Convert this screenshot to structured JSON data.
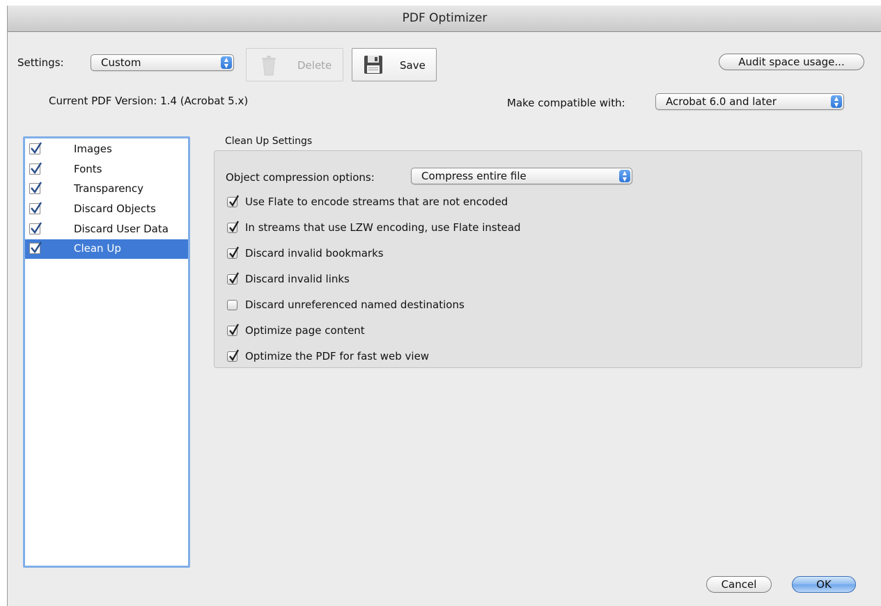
{
  "window": {
    "title": "PDF Optimizer"
  },
  "toolbar": {
    "settings_label": "Settings:",
    "settings_value": "Custom",
    "delete_label": "Delete",
    "save_label": "Save",
    "audit_label": "Audit space usage..."
  },
  "version": {
    "current_text": "Current PDF Version: 1.4 (Acrobat 5.x)",
    "compat_label": "Make compatible with:",
    "compat_value": "Acrobat 6.0 and later"
  },
  "sidebar": {
    "items": [
      {
        "label": "Images",
        "checked": true,
        "selected": false
      },
      {
        "label": "Fonts",
        "checked": true,
        "selected": false
      },
      {
        "label": "Transparency",
        "checked": true,
        "selected": false
      },
      {
        "label": "Discard Objects",
        "checked": true,
        "selected": false
      },
      {
        "label": "Discard User Data",
        "checked": true,
        "selected": false
      },
      {
        "label": "Clean Up",
        "checked": true,
        "selected": true
      }
    ]
  },
  "cleanup": {
    "section_title": "Clean Up Settings",
    "compression_label": "Object compression options:",
    "compression_value": "Compress entire file",
    "options": [
      {
        "label": "Use Flate to encode streams that are not encoded",
        "checked": true
      },
      {
        "label": "In streams that use LZW encoding, use Flate instead",
        "checked": true
      },
      {
        "label": "Discard invalid bookmarks",
        "checked": true
      },
      {
        "label": "Discard invalid links",
        "checked": true
      },
      {
        "label": "Discard unreferenced named destinations",
        "checked": false
      },
      {
        "label": "Optimize page content",
        "checked": true
      },
      {
        "label": "Optimize the PDF for fast web view",
        "checked": true
      }
    ]
  },
  "footer": {
    "cancel_label": "Cancel",
    "ok_label": "OK"
  },
  "colors": {
    "accent": "#3f7bd6",
    "focus_ring": "#80aee8",
    "checkmark": "#2a4f8a"
  }
}
